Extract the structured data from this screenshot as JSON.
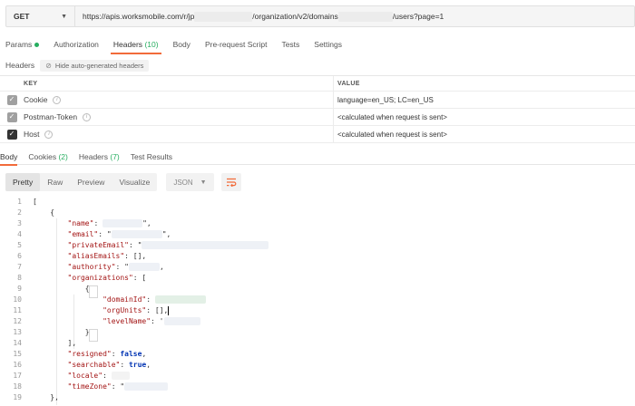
{
  "request": {
    "method": "GET",
    "url_parts": [
      "https://apis.worksmobile.com/r/jp",
      "/organization/v2/domains",
      "/users?page=1"
    ]
  },
  "request_tabs": [
    {
      "label": "Params",
      "count": "",
      "dot": true
    },
    {
      "label": "Authorization",
      "count": ""
    },
    {
      "label": "Headers",
      "count": "(10)",
      "active": true
    },
    {
      "label": "Body",
      "count": ""
    },
    {
      "label": "Pre-request Script",
      "count": ""
    },
    {
      "label": "Tests",
      "count": ""
    },
    {
      "label": "Settings",
      "count": ""
    }
  ],
  "headers_section": {
    "label": "Headers",
    "hide_auto_label": "Hide auto-generated headers",
    "columns": {
      "key": "KEY",
      "value": "VALUE"
    },
    "rows": [
      {
        "key": "Cookie",
        "value": "language=en_US; LC=en_US",
        "checked": true
      },
      {
        "key": "Postman-Token",
        "value": "<calculated when request is sent>",
        "checked": true
      },
      {
        "key": "Host",
        "value": "<calculated when request is sent>",
        "checked": true
      }
    ]
  },
  "response_tabs": [
    {
      "label": "Body",
      "count": "",
      "active": true
    },
    {
      "label": "Cookies",
      "count": "(2)"
    },
    {
      "label": "Headers",
      "count": "(7)"
    },
    {
      "label": "Test Results",
      "count": ""
    }
  ],
  "response_toolbar": {
    "views": [
      "Pretty",
      "Raw",
      "Preview",
      "Visualize"
    ],
    "active_view": "Pretty",
    "format": "JSON"
  },
  "code": {
    "line_numbers": [
      "1",
      "2",
      "3",
      "4",
      "5",
      "6",
      "7",
      "8",
      "9",
      "10",
      "11",
      "12",
      "13",
      "14",
      "15",
      "16",
      "17",
      "18",
      "19"
    ],
    "l1": "[",
    "l2": "{",
    "k_name": "\"name\"",
    "k_email": "\"email\"",
    "k_privateEmail": "\"privateEmail\"",
    "k_aliasEmails": "\"aliasEmails\"",
    "v_aliasEmails": "[],",
    "k_authority": "\"authority\"",
    "k_organizations": "\"organizations\"",
    "v_organizations": "[",
    "l9": "{",
    "k_domainId": "\"domainId\"",
    "k_orgUnits": "\"orgUnits\"",
    "v_orgUnits": "[],",
    "k_levelName": "\"levelName\"",
    "l13": "}",
    "l14": "],",
    "k_resigned": "\"resigned\"",
    "v_resigned": "false",
    "k_searchable": "\"searchable\"",
    "v_searchable": "true",
    "k_locale": "\"locale\"",
    "k_timeZone": "\"timeZone\"",
    "l19": "},"
  }
}
